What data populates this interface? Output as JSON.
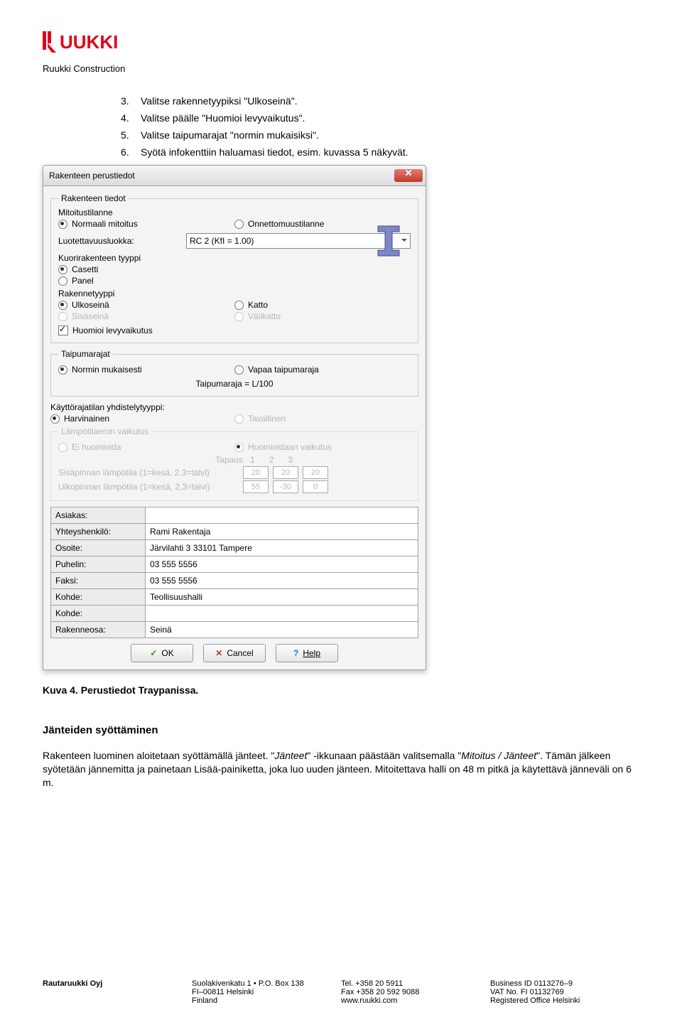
{
  "header": {
    "logo_text": "RUUKKI",
    "company_sub": "Ruukki Construction"
  },
  "steps": [
    {
      "n": "3.",
      "text": "Valitse rakennetyypiksi \"Ulkoseinä\"."
    },
    {
      "n": "4.",
      "text": "Valitse päälle \"Huomioi levyvaikutus\"."
    },
    {
      "n": "5.",
      "text": "Valitse taipumarajat \"normin mukaisiksi\"."
    },
    {
      "n": "6.",
      "text": "Syötä infokenttiin haluamasi tiedot, esim. kuvassa 5 näkyvät."
    }
  ],
  "dialog": {
    "title": "Rakenteen perustiedot",
    "g_rt": {
      "legend": "Rakenteen tiedot",
      "l_mt": "Mitoitustilanne",
      "r_norm": "Normaali mitoitus",
      "r_onn": "Onnettomuustilanne",
      "l_luok": "Luotettavuusluokka:",
      "combo": "RC 2  (KfI = 1.00)",
      "l_kuor": "Kuorirakenteen tyyppi",
      "r_cas": "Casetti",
      "r_pan": "Panel",
      "l_rak": "Rakennetyyppi",
      "r_ulko": "Ulkoseinä",
      "r_katto": "Katto",
      "r_sisa": "Sisäseinä",
      "r_vali": "Välikatto",
      "chk_levy": "Huomioi levyvaikutus"
    },
    "g_tp": {
      "legend": "Taipumarajat",
      "r_norm": "Normin mukaisesti",
      "r_vapaa": "Vapaa taipumaraja",
      "eq": "Taipumaraja =   L/100"
    },
    "g_yt": {
      "label": "Käyttörajatilan yhdistelytyyppi:",
      "r_harv": "Harvinainen",
      "r_tav": "Tavallinen"
    },
    "g_lt": {
      "legend": "Lämpötilaeron vaikutus",
      "r_ei": "Ei huomioida",
      "r_huom": "Huomioidaan vaikutus",
      "l_tap": "Tapaus",
      "c1": "1",
      "c2": "2",
      "c3": "3",
      "l_sisa": "Sisäpinnan lämpötila  (1=kesä, 2,3=talvi)",
      "v_sisa": [
        "20",
        "20",
        "20"
      ],
      "l_ulko": "Ulkopinnan lämpötila  (1=kesä, 2,3=talvi)",
      "v_ulko": [
        "55",
        "-30",
        "0"
      ]
    },
    "info": [
      {
        "lab": "Asiakas:",
        "val": ""
      },
      {
        "lab": "Yhteyshenkilö:",
        "val": "Rami Rakentaja"
      },
      {
        "lab": "Osoite:",
        "val": "Järvilahti 3 33101 Tampere"
      },
      {
        "lab": "Puhelin:",
        "val": "03 555 5556"
      },
      {
        "lab": "Faksi:",
        "val": "03 555 5556"
      },
      {
        "lab": "Kohde:",
        "val": "Teollisuushalli"
      },
      {
        "lab": "Kohde:",
        "val": ""
      },
      {
        "lab": "Rakenneosa:",
        "val": "Seinä"
      }
    ],
    "btn_ok": "OK",
    "btn_cancel": "Cancel",
    "btn_help": "Help"
  },
  "caption": "Kuva 4. Perustiedot Traypanissa.",
  "section2": {
    "title": "Jänteiden syöttäminen",
    "p1a": "Rakenteen luominen aloitetaan syöttämällä jänteet. \"",
    "p1b": "Jänteet",
    "p1c": "\" -ikkunaan päästään valitsemalla \"",
    "p1d": "Mitoitus / Jänteet",
    "p1e": "\". Tämän jälkeen syötetään jännemitta ja painetaan Lisää-painiketta, joka luo uuden jänteen. Mitoitettava halli on 48 m pitkä ja käytettävä jänneväli on 6 m."
  },
  "footer": {
    "c1": [
      "Rautaruukki Oyj"
    ],
    "c2": [
      "Suolakivenkatu 1 • P.O. Box 138",
      "FI–00811 Helsinki",
      "Finland"
    ],
    "c3": [
      "Tel.  +358 20 5911",
      "Fax +358 20 592 9088",
      "www.ruukki.com"
    ],
    "c4": [
      "Business ID 0113276–9",
      "VAT No. FI 01132769",
      "Registered Office Helsinki"
    ]
  }
}
